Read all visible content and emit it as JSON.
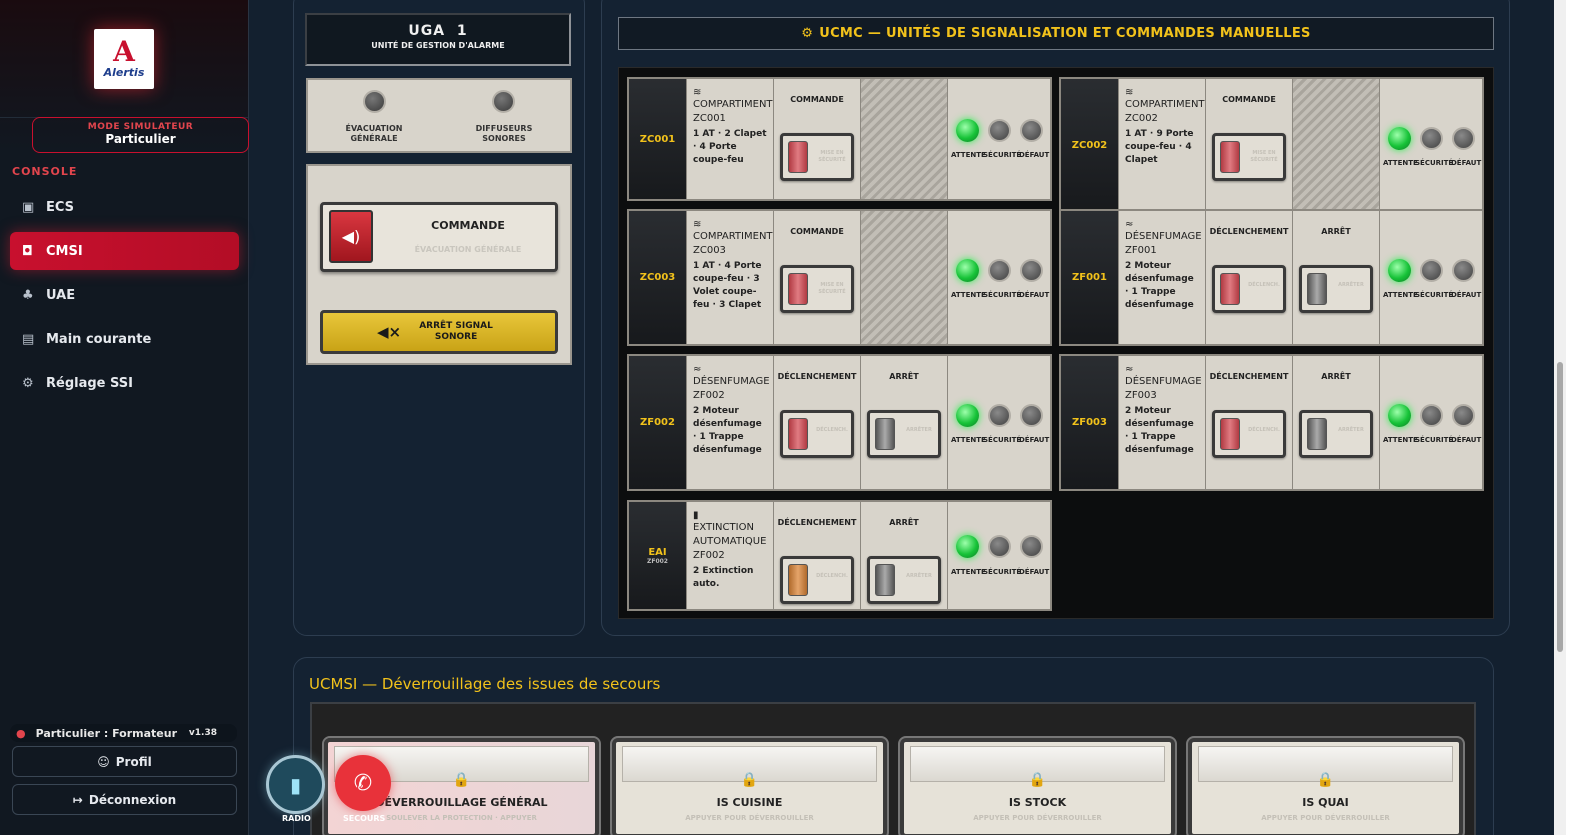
{
  "sidebar": {
    "logo_text": "Alertis",
    "mode_label": "MODE SIMULATEUR",
    "mode_value": "Particulier",
    "section": "CONSOLE",
    "items": [
      {
        "label": "ECS",
        "icon": "chip-icon",
        "glyph": "▣"
      },
      {
        "label": "CMSI",
        "icon": "fire-extinguisher-icon",
        "glyph": "◘"
      },
      {
        "label": "UAE",
        "icon": "network-icon",
        "glyph": "♣"
      },
      {
        "label": "Main courante",
        "icon": "logbook-icon",
        "glyph": "▤"
      },
      {
        "label": "Réglage SSI",
        "icon": "gear-icon",
        "glyph": "⚙"
      }
    ],
    "user": "Particulier : Formateur",
    "version": "v1.38",
    "profile": "Profil",
    "logout": "Déconnexion"
  },
  "uga": {
    "title": "UGA  1",
    "subtitle": "UNITÉ DE GESTION D'ALARME",
    "led1": "ÉVACUATION GÉNÉRALE",
    "led2": "DIFFUSEURS SONORES",
    "command": "COMMANDE",
    "command_sub": "ÉVACUATION GÉNÉRALE",
    "stop": "ARRÊT SIGNAL SONORE"
  },
  "ucmc": {
    "title": "UCMC — UNITÉS DE SIGNALISATION ET COMMANDES MANUELLES",
    "status_labels": [
      "ATTENTE",
      "SÉCURITÉ",
      "DÉFAUT"
    ],
    "modules": [
      {
        "id": "ZC001",
        "sub": "",
        "icon": "≋",
        "name": "COMPARTIMENT ZC001",
        "details": "1 AT · 2 Clapet · 4 Porte coupe-feu",
        "c1": "COMMANDE",
        "b1": "MISE EN SÉCURITÉ",
        "k1": "red",
        "c2": "",
        "b2": "",
        "k2": ""
      },
      {
        "id": "ZC002",
        "sub": "",
        "icon": "≋",
        "name": "COMPARTIMENT ZC002",
        "details": "1 AT · 9 Porte coupe-feu · 4 Clapet",
        "c1": "COMMANDE",
        "b1": "MISE EN SÉCURITÉ",
        "k1": "red",
        "c2": "",
        "b2": "",
        "k2": ""
      },
      {
        "id": "ZC003",
        "sub": "",
        "icon": "≋",
        "name": "COMPARTIMENT ZC003",
        "details": "1 AT · 4 Porte coupe-feu · 3 Volet coupe-feu · 3 Clapet",
        "c1": "COMMANDE",
        "b1": "MISE EN SÉCURITÉ",
        "k1": "red",
        "c2": "",
        "b2": "",
        "k2": ""
      },
      {
        "id": "ZF001",
        "sub": "",
        "icon": "≈",
        "name": "DÉSENFUMAGE ZF001",
        "details": "2 Moteur désenfumage · 1 Trappe désenfumage",
        "c1": "DÉCLENCHEMENT",
        "b1": "DÉCLENCH.",
        "k1": "red",
        "c2": "ARRÊT",
        "b2": "ARRÊTER",
        "k2": "grey"
      },
      {
        "id": "ZF002",
        "sub": "",
        "icon": "≈",
        "name": "DÉSENFUMAGE ZF002",
        "details": "2 Moteur désenfumage · 1 Trappe désenfumage",
        "c1": "DÉCLENCHEMENT",
        "b1": "DÉCLENCH.",
        "k1": "red",
        "c2": "ARRÊT",
        "b2": "ARRÊTER",
        "k2": "grey"
      },
      {
        "id": "ZF003",
        "sub": "",
        "icon": "≈",
        "name": "DÉSENFUMAGE ZF003",
        "details": "2 Moteur désenfumage · 1 Trappe désenfumage",
        "c1": "DÉCLENCHEMENT",
        "b1": "DÉCLENCH.",
        "k1": "red",
        "c2": "ARRÊT",
        "b2": "ARRÊTER",
        "k2": "grey"
      },
      {
        "id": "EAI",
        "sub": "ZF002",
        "icon": "▮",
        "name": "EXTINCTION AUTOMATIQUE ZF002",
        "details": "2 Extinction auto.",
        "c1": "DÉCLENCHEMENT",
        "b1": "DÉCLENCH.",
        "k1": "orange",
        "c2": "ARRÊT",
        "b2": "ARRÊTER",
        "k2": "grey"
      }
    ]
  },
  "ucmsi": {
    "title": "UCMSI — Déverrouillage des issues de secours",
    "issues": [
      {
        "label": "DÉVERROUILLAGE GÉNÉRAL",
        "sub": "SOULEVER LA PROTECTION · APPUYER"
      },
      {
        "label": "IS CUISINE",
        "sub": "APPUYER POUR DÉVERROUILLER"
      },
      {
        "label": "IS STOCK",
        "sub": "APPUYER POUR DÉVERROUILLER"
      },
      {
        "label": "IS QUAI",
        "sub": "APPUYER POUR DÉVERROUILLER"
      }
    ]
  },
  "fab": {
    "radio": "RADIO",
    "secours": "SECOURS"
  }
}
